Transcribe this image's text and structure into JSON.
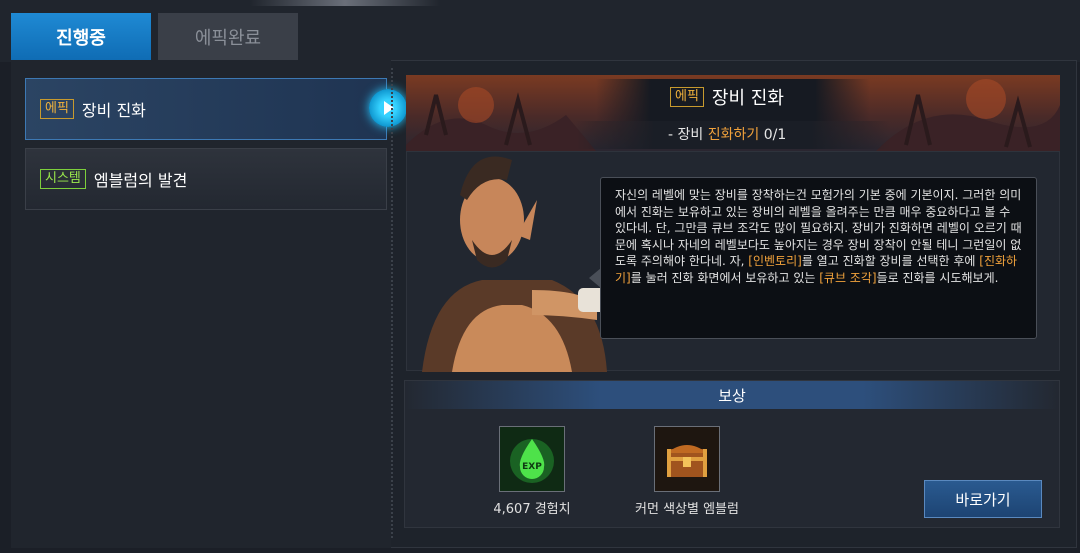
{
  "tabs": [
    {
      "label": "진행중",
      "active": true
    },
    {
      "label": "에픽완료",
      "active": false
    }
  ],
  "quests": [
    {
      "tag": "에픽",
      "title": "장비 진화",
      "selected": true
    },
    {
      "tag": "시스템",
      "title": "엠블럼의 발견",
      "selected": false
    }
  ],
  "detail": {
    "tag": "에픽",
    "title": "장비 진화",
    "objective_prefix": "- 장비",
    "objective_highlight": "진화하기",
    "objective_progress": "0/1"
  },
  "dialog": {
    "text_1": "자신의 레벨에 맞는 장비를 장착하는건 모험가의 기본 중에 기본이지. 그러한 의미에서 진화는 보유하고 있는 장비의 레벨을 올려주는 만큼 매우 중요하다고 볼 수 있다네. 단, 그만큼 큐브 조각도 많이 필요하지. 장비가 진화하면 레벨이 오르기 때문에 혹시나 자네의 레벨보다도 높아지는 경우 장비 장착이 안될 테니 그런일이 없도록 주의해야 한다네. 자, ",
    "hl_1": "[인벤토리]",
    "text_2": "를 열고 진화할 장비를 선택한 후에 ",
    "hl_2": "[진화하기]",
    "text_3": "를 눌러 진화 화면에서 보유하고 있는 ",
    "hl_3": "[큐브 조각]",
    "text_4": "들로 진화를 시도해보게."
  },
  "reward": {
    "header": "보상",
    "items": [
      {
        "label": "4,607 경험치",
        "icon": "exp-potion-icon"
      },
      {
        "label": "커먼 색상별 엠블럼",
        "icon": "treasure-chest-icon"
      }
    ],
    "go_label": "바로가기"
  },
  "colors": {
    "tab_active": "#1f8ad4",
    "epic_tag": "#f1b23c",
    "system_tag": "#9bea4c",
    "highlight": "#f1a23c",
    "button": "#2a5a90"
  }
}
